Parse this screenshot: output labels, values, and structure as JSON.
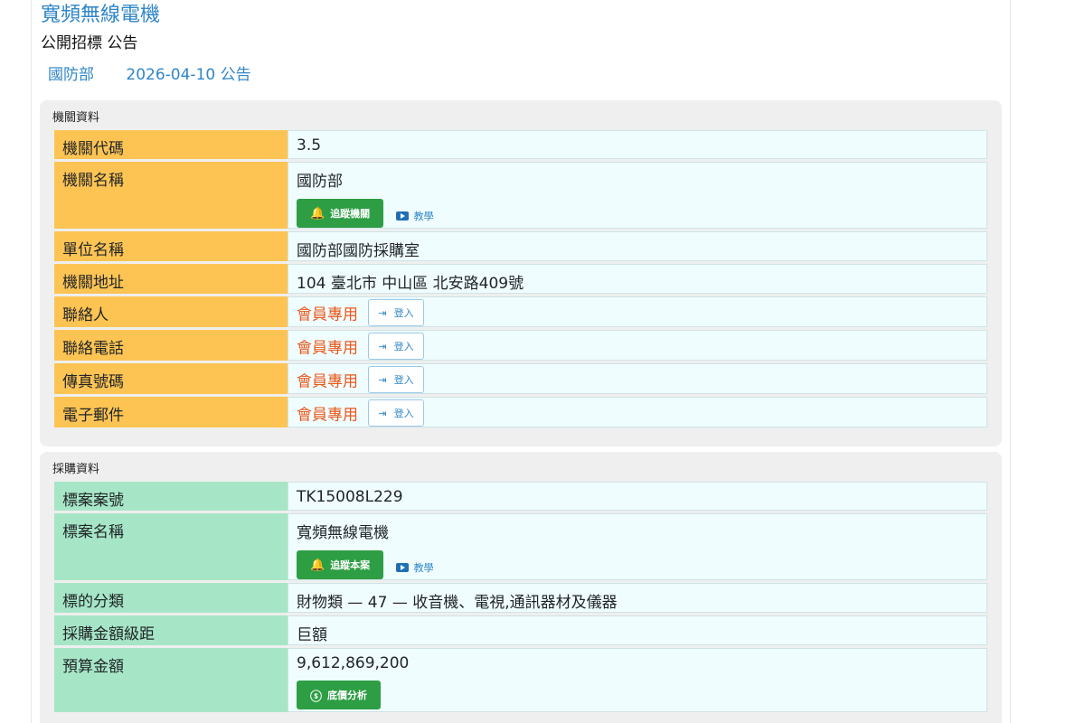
{
  "header": {
    "title": "寬頻無線電機",
    "subtitle": "公開招標 公告",
    "agency": "國防部",
    "announce": "2026-04-10 公告"
  },
  "agency_section": {
    "heading": "機關資料",
    "rows": [
      {
        "label": "機關代碼",
        "value": "3.5"
      },
      {
        "label": "機關名稱",
        "value": "國防部",
        "follow_btn": "追蹤機關",
        "tutorial": "教學"
      },
      {
        "label": "單位名稱",
        "value": "國防部國防採購室"
      },
      {
        "label": "機關地址",
        "value": "104 臺北市 中山區 北安路409號"
      },
      {
        "label": "聯絡人",
        "members": "會員專用",
        "login": "登入"
      },
      {
        "label": "聯絡電話",
        "members": "會員專用",
        "login": "登入"
      },
      {
        "label": "傳真號碼",
        "members": "會員專用",
        "login": "登入"
      },
      {
        "label": "電子郵件",
        "members": "會員專用",
        "login": "登入"
      }
    ]
  },
  "procurement_section": {
    "heading": "採購資料",
    "rows": [
      {
        "label": "標案案號",
        "value": "TK15008L229"
      },
      {
        "label": "標案名稱",
        "value": "寬頻無線電機",
        "follow_btn": "追蹤本案",
        "tutorial": "教學"
      },
      {
        "label": "標的分類",
        "value": "財物類 — 47 — 收音機、電視,通訊器材及儀器"
      },
      {
        "label": "採購金額級距",
        "value": "巨額"
      },
      {
        "label": "預算金額",
        "value": "9,612,869,200",
        "analysis_btn": "底價分析"
      }
    ]
  },
  "colors": {
    "accent": "#2f86c8",
    "agency_label_bg": "#fdc453",
    "procurement_label_bg": "#a6e6c6",
    "button_green": "#2e9e44",
    "members_text": "#e8591c"
  },
  "icons": {
    "follow": "bell-plus-icon",
    "tutorial": "youtube-icon",
    "login": "sign-in-icon",
    "analysis": "dollar-circle-icon"
  }
}
